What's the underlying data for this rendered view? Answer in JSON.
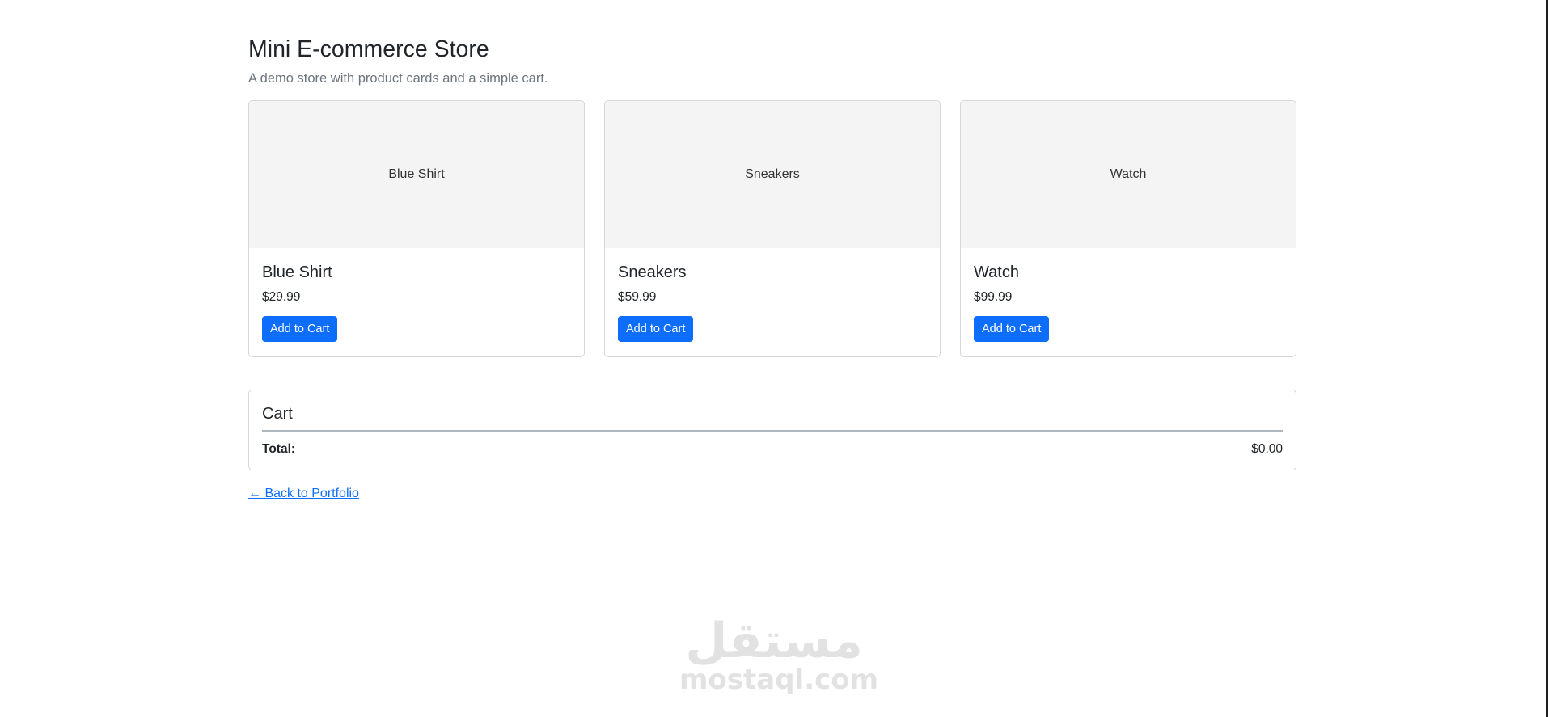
{
  "header": {
    "title": "Mini E-commerce Store",
    "subtitle": "A demo store with product cards and a simple cart."
  },
  "products": [
    {
      "image_label": "Blue Shirt",
      "name": "Blue Shirt",
      "price": "$29.99",
      "button_label": "Add to Cart"
    },
    {
      "image_label": "Sneakers",
      "name": "Sneakers",
      "price": "$59.99",
      "button_label": "Add to Cart"
    },
    {
      "image_label": "Watch",
      "name": "Watch",
      "price": "$99.99",
      "button_label": "Add to Cart"
    }
  ],
  "cart": {
    "title": "Cart",
    "total_label": "Total:",
    "total_value": "$0.00"
  },
  "back_link": {
    "label": "← Back to Portfolio"
  },
  "watermark": {
    "arabic": "مستقل",
    "latin": "mostaql.com"
  },
  "colors": {
    "primary": "#0d6efd",
    "muted_text": "#6c757d",
    "image_placeholder": "#f4f4f4"
  }
}
